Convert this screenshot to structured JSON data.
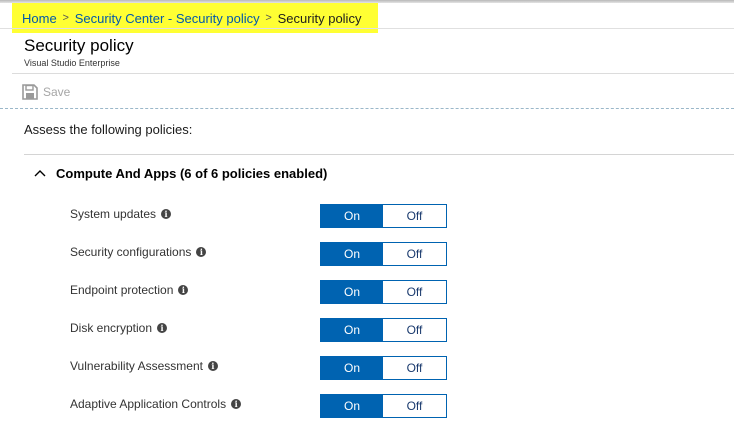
{
  "breadcrumb": {
    "items": [
      "Home",
      "Security Center - Security policy",
      "Security policy"
    ],
    "separator": ">"
  },
  "header": {
    "title": "Security policy",
    "subtitle": "Visual Studio Enterprise"
  },
  "toolbar": {
    "save_label": "Save",
    "save_icon": "floppy-disk-icon"
  },
  "main": {
    "intro": "Assess the following policies:",
    "group": {
      "title": "Compute And Apps (6 of 6 policies enabled)",
      "expanded": true,
      "policies": [
        {
          "label": "System updates",
          "on_label": "On",
          "off_label": "Off",
          "state": "On"
        },
        {
          "label": "Security configurations",
          "on_label": "On",
          "off_label": "Off",
          "state": "On"
        },
        {
          "label": "Endpoint protection",
          "on_label": "On",
          "off_label": "Off",
          "state": "On"
        },
        {
          "label": "Disk encryption",
          "on_label": "On",
          "off_label": "Off",
          "state": "On"
        },
        {
          "label": "Vulnerability Assessment",
          "on_label": "On",
          "off_label": "Off",
          "state": "On"
        },
        {
          "label": "Adaptive Application Controls",
          "on_label": "On",
          "off_label": "Off",
          "state": "On"
        }
      ]
    }
  },
  "colors": {
    "breadcrumb_highlight": "#ffff33",
    "link": "#0058ad",
    "toggle_active": "#0063b1"
  }
}
